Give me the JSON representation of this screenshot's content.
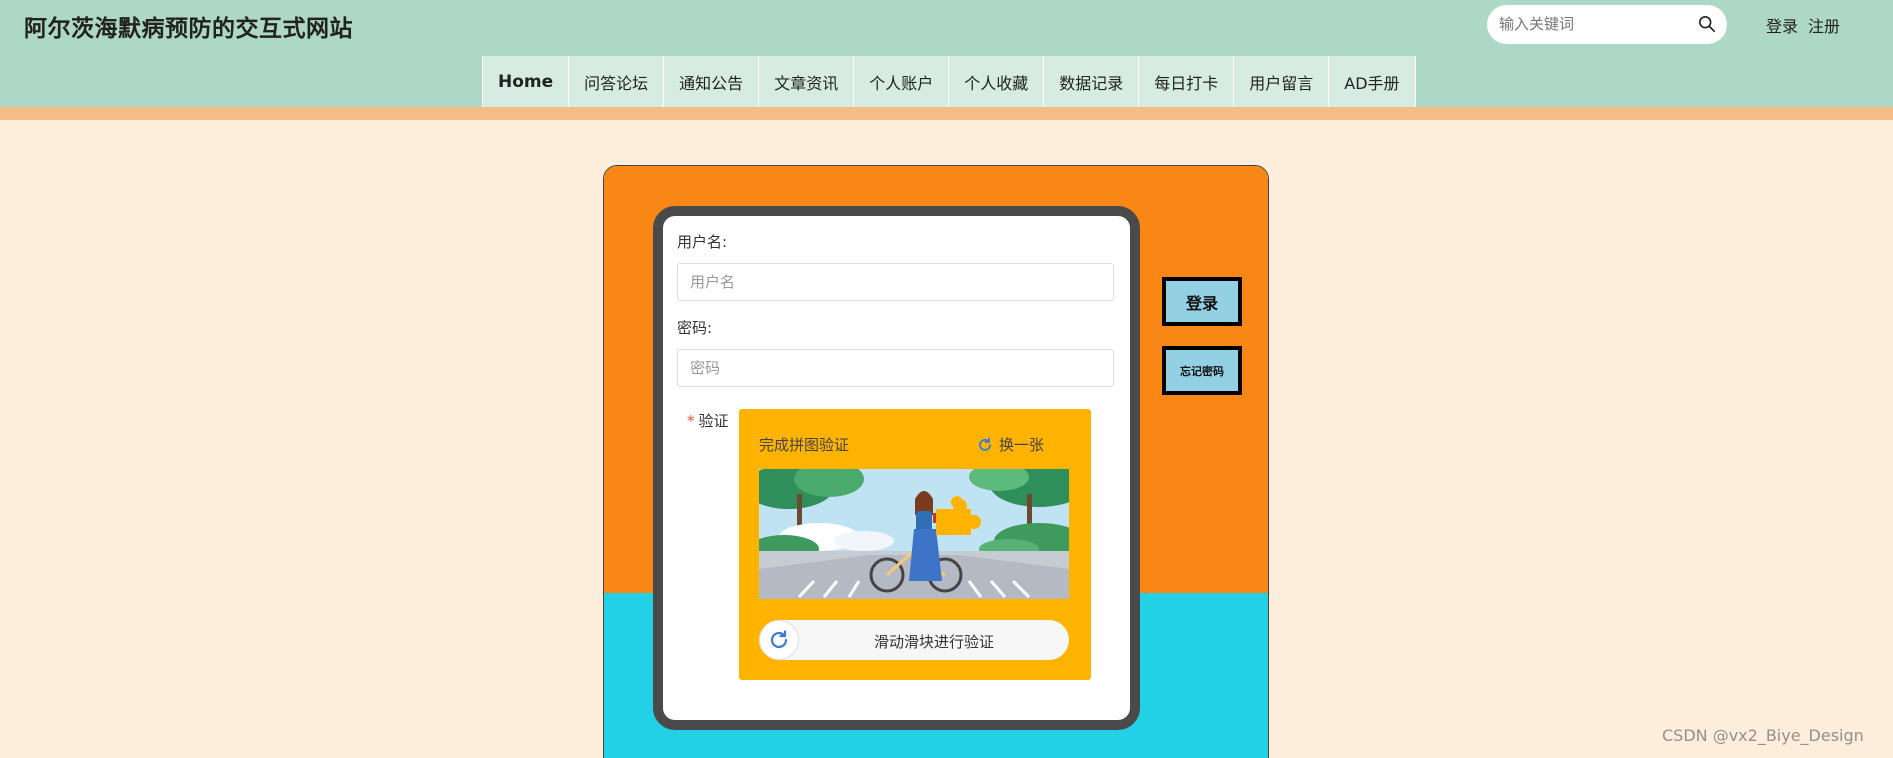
{
  "header": {
    "site_title": "阿尔茨海默病预防的交互式网站",
    "search_placeholder": "输入关键词",
    "login_link": "登录",
    "register_link": "注册"
  },
  "nav": {
    "items": [
      "Home",
      "问答论坛",
      "通知公告",
      "文章资讯",
      "个人账户",
      "个人收藏",
      "数据记录",
      "每日打卡",
      "用户留言",
      "AD手册"
    ]
  },
  "login_form": {
    "username_label": "用户名:",
    "username_placeholder": "用户名",
    "password_label": "密码:",
    "password_placeholder": "密码",
    "verify_required_mark": "*",
    "verify_label": "验证",
    "captcha_title": "完成拼图验证",
    "captcha_refresh_label": "换一张",
    "slider_text": "滑动滑块进行验证"
  },
  "actions": {
    "login_button": "登录",
    "forgot_button": "忘记密码"
  },
  "watermark": "CSDN @vx2_Biye_Design",
  "colors": {
    "header_bg": "#acd8c5",
    "page_bg": "#fdeedb",
    "card_orange": "#f98716",
    "card_cyan": "#22d1e6",
    "captcha_bg": "#ffb301",
    "side_button_bg": "#94d0e3"
  }
}
